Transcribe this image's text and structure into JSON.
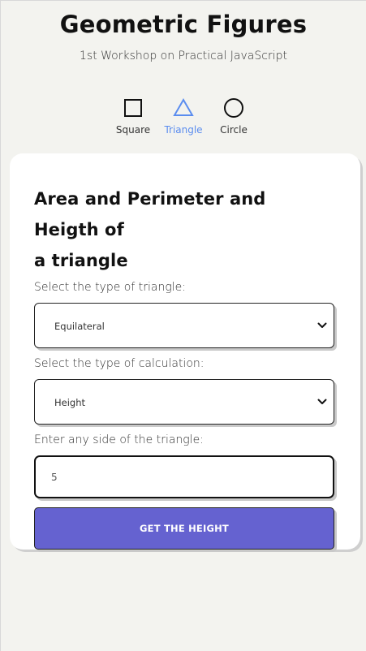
{
  "header": {
    "title": "Geometric Figures",
    "subtitle": "1st Workshop on Practical JavaScript"
  },
  "nav": {
    "tabs": [
      {
        "label": "Square",
        "icon": "square-icon",
        "active": false
      },
      {
        "label": "Triangle",
        "icon": "triangle-icon",
        "active": true
      },
      {
        "label": "Circle",
        "icon": "circle-icon",
        "active": false
      }
    ]
  },
  "card": {
    "title_line1": "Area and Perimeter and Heigth of",
    "title_line2": "a triangle",
    "triangle_type": {
      "label": "Select the type of triangle:",
      "value": "Equilateral"
    },
    "calc_type": {
      "label": "Select the type of calculation:",
      "value": "Height"
    },
    "side": {
      "label": "Enter any side of the triangle:",
      "value": "5"
    },
    "button_label": "GET THE HEIGHT"
  },
  "colors": {
    "background": "#f3f3ef",
    "accent": "#5b8def",
    "button": "#6562d0"
  }
}
